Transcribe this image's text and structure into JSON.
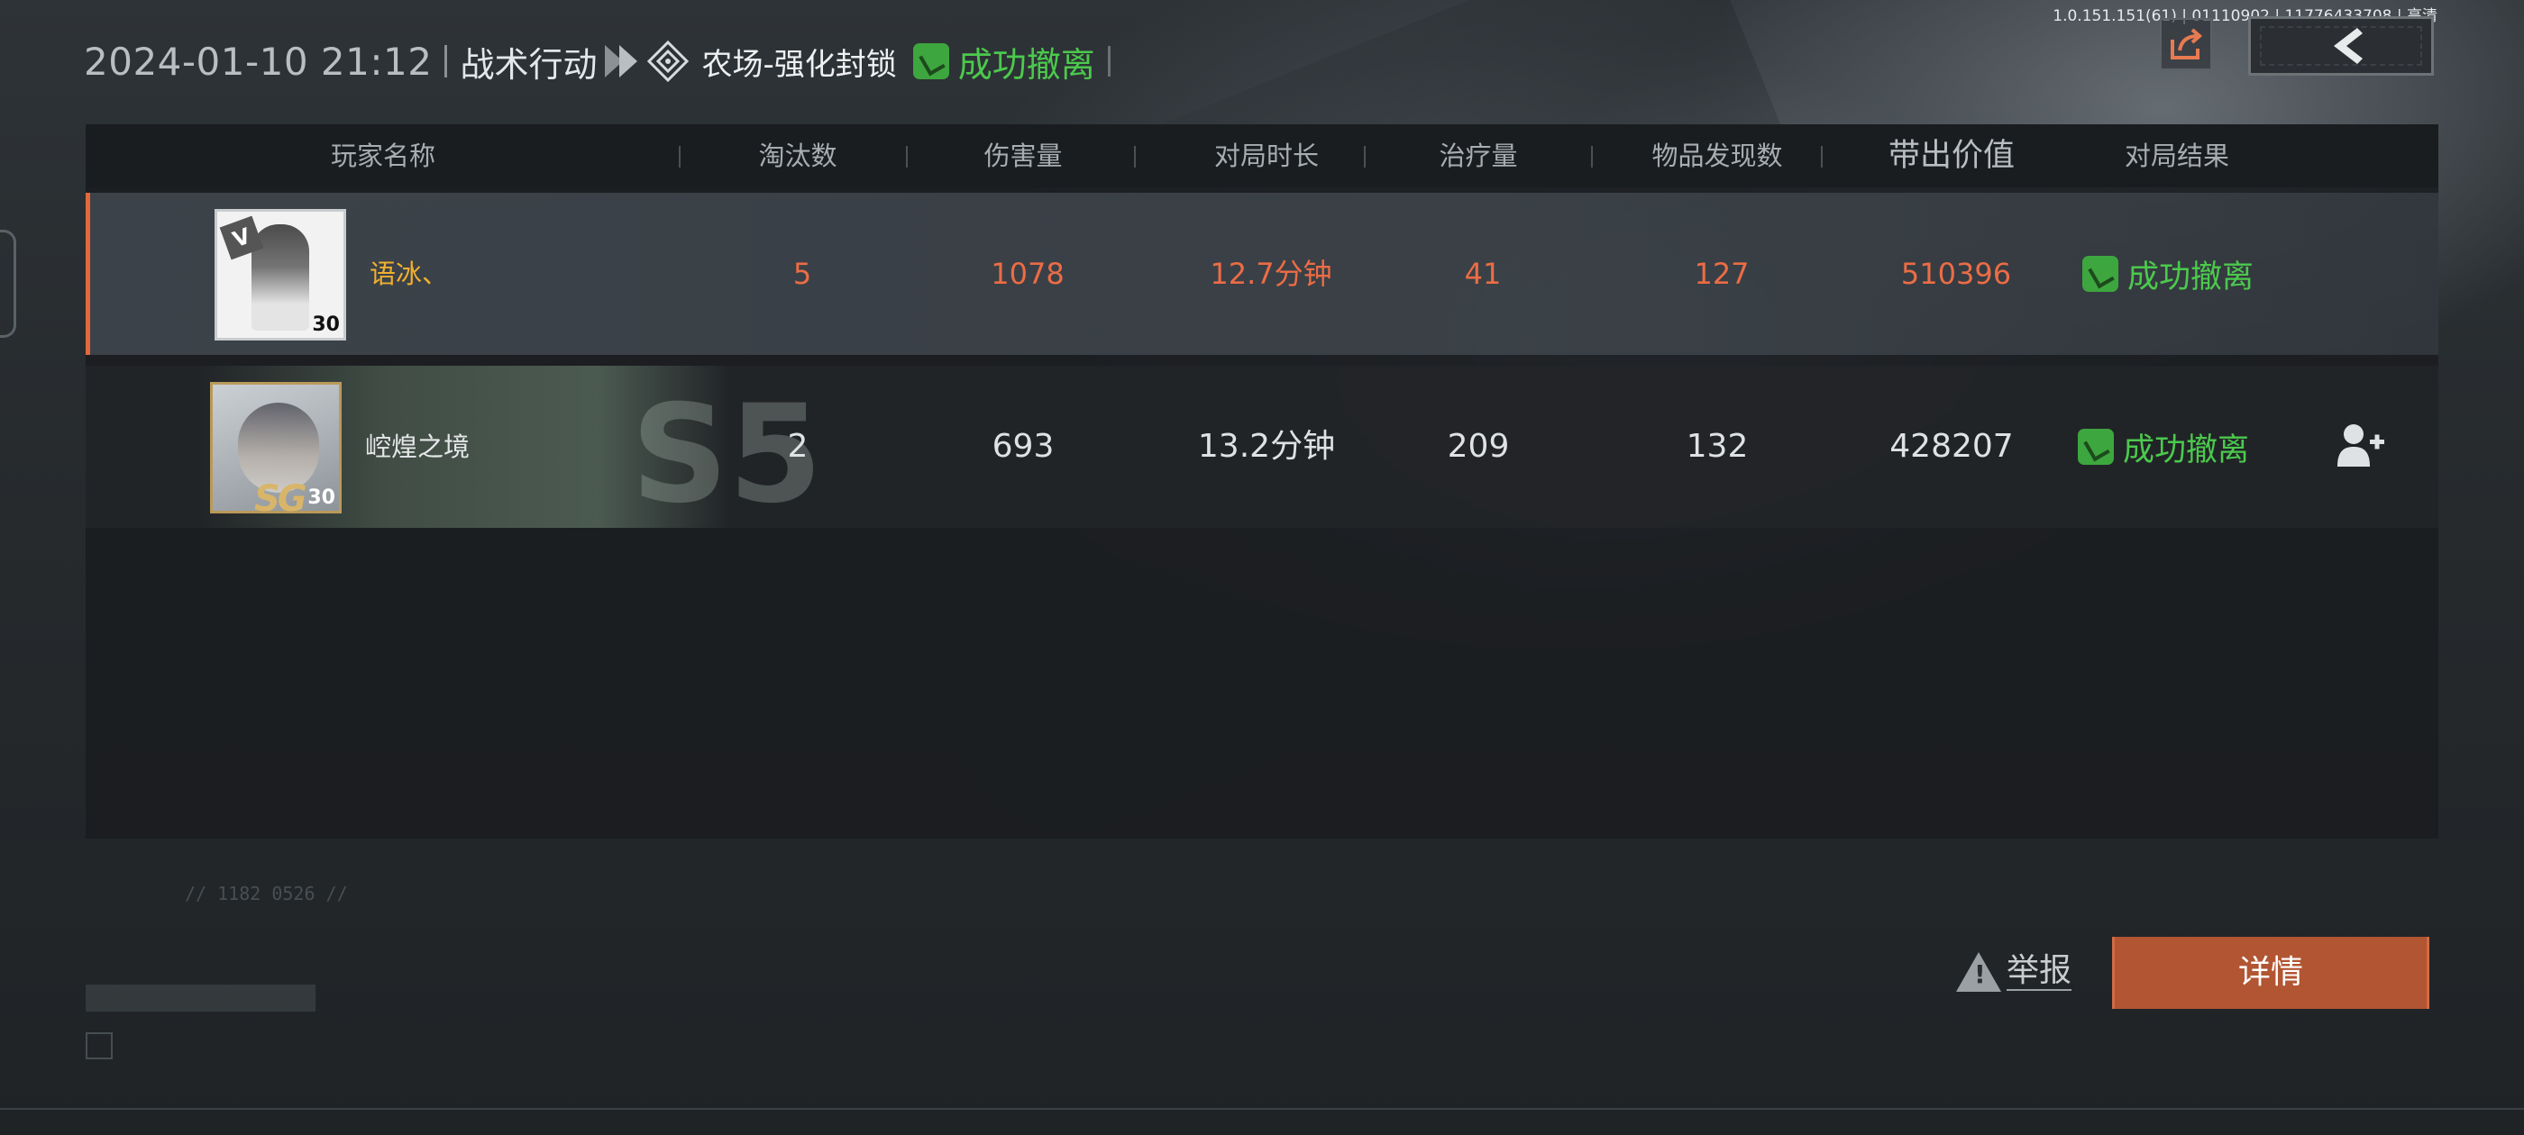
{
  "header": {
    "datetime": "2024-01-10 21:12",
    "mode": "战术行动",
    "map": "农场-强化封锁",
    "status": "成功撤离"
  },
  "version_text": "1.0.151.151(61) | 01110902 | 11776433708 | 高清",
  "table": {
    "columns": [
      "玩家名称",
      "淘汰数",
      "伤害量",
      "对局时长",
      "治疗量",
      "物品发现数",
      "带出价值",
      "对局结果"
    ],
    "rows": [
      {
        "name": "语冰、",
        "level": "30",
        "kills": "5",
        "damage": "1078",
        "duration": "12.7分钟",
        "healing": "41",
        "items": "127",
        "value": "510396",
        "result": "成功撤离"
      },
      {
        "name": "崆煌之境",
        "level": "30",
        "kills": "2",
        "damage": "693",
        "duration": "13.2分钟",
        "healing": "209",
        "items": "132",
        "value": "428207",
        "result": "成功撤离"
      }
    ]
  },
  "buttons": {
    "report": "举报",
    "details": "详情"
  },
  "icons": {
    "share": "share-icon",
    "back": "back-arrow-icon",
    "add_friend": "add-friend-icon",
    "warning": "warning-icon",
    "success": "success-hand-icon",
    "map": "map-diamond-icon"
  },
  "colors": {
    "highlight_orange": "#ec6c45",
    "success_green": "#4cc94d",
    "details_button": "#b25532",
    "player_name_gold": "#f0b030"
  }
}
